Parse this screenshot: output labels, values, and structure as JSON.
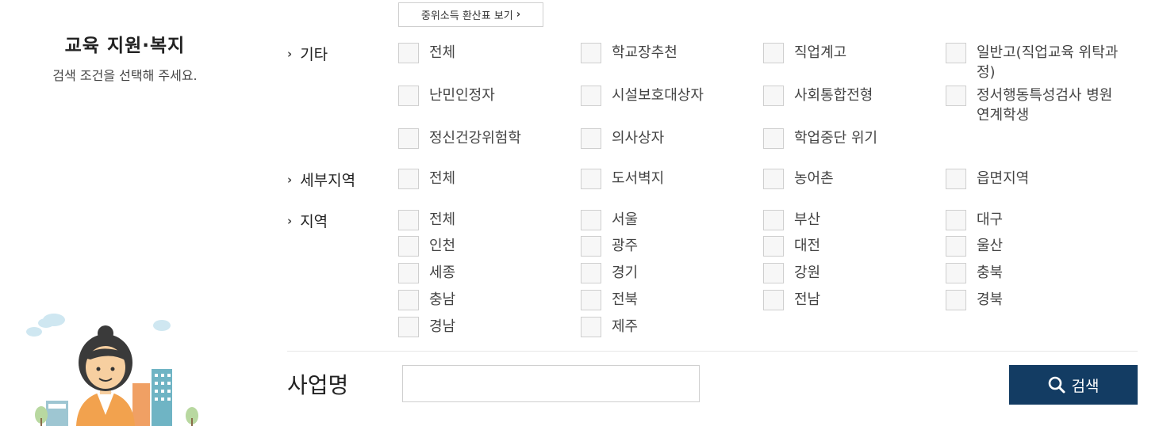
{
  "sidebar": {
    "title": "교육 지원·복지",
    "subtitle": "검색 조건을 선택해 주세요."
  },
  "income_button": {
    "label": "중위소득 환산표 보기",
    "icon": "chevron-right-icon"
  },
  "categories": {
    "etc": {
      "label": "기타",
      "options": [
        "전체",
        "학교장추천",
        "직업계고",
        "일반고(직업교육 위탁과정)",
        "난민인정자",
        "시설보호대상자",
        "사회통합전형",
        "정서행동특성검사 병원연계학생",
        "정신건강위험학",
        "의사상자",
        "학업중단 위기"
      ]
    },
    "subregion": {
      "label": "세부지역",
      "options": [
        "전체",
        "도서벽지",
        "농어촌",
        "읍면지역"
      ]
    },
    "region": {
      "label": "지역",
      "options": [
        "전체",
        "서울",
        "부산",
        "대구",
        "인천",
        "광주",
        "대전",
        "울산",
        "세종",
        "경기",
        "강원",
        "충북",
        "충남",
        "전북",
        "전남",
        "경북",
        "경남",
        "제주"
      ]
    }
  },
  "business_name": {
    "label": "사업명",
    "value": "",
    "placeholder": ""
  },
  "search_button": {
    "label": "검색",
    "icon": "search-icon"
  },
  "colors": {
    "primary": "#133c63",
    "border": "#cfcfcf",
    "checkbox_bg": "#f7f7f7"
  }
}
